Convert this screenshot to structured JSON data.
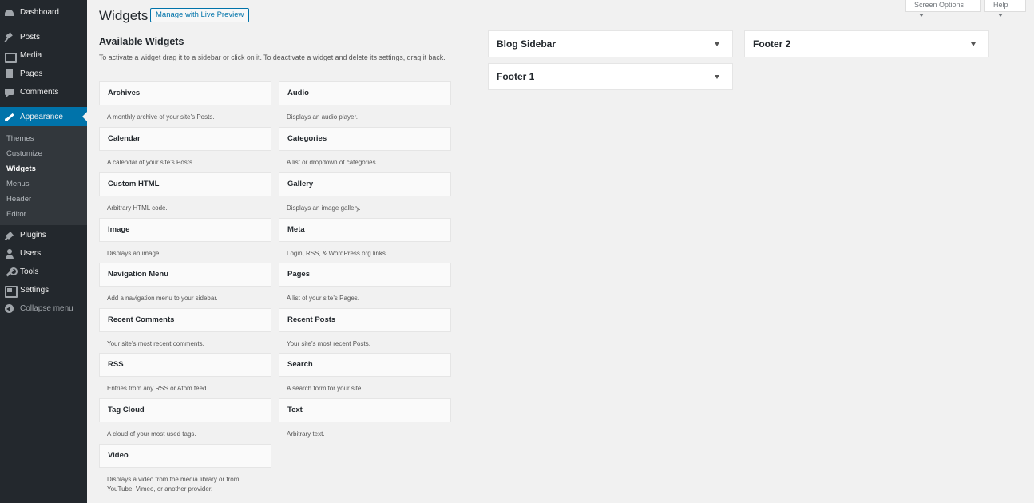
{
  "menu": {
    "items": [
      {
        "label": "Dashboard",
        "icon": "dashboard-icon"
      },
      {
        "label": "Posts",
        "icon": "pushpin-icon"
      },
      {
        "label": "Media",
        "icon": "media-icon"
      },
      {
        "label": "Pages",
        "icon": "pages-icon"
      },
      {
        "label": "Comments",
        "icon": "comments-icon"
      },
      {
        "label": "Appearance",
        "icon": "paintbrush-icon"
      },
      {
        "label": "Plugins",
        "icon": "plugin-icon"
      },
      {
        "label": "Users",
        "icon": "users-icon"
      },
      {
        "label": "Tools",
        "icon": "wrench-icon"
      },
      {
        "label": "Settings",
        "icon": "settings-icon"
      },
      {
        "label": "Collapse menu",
        "icon": "collapse-icon"
      }
    ],
    "submenu": [
      "Themes",
      "Customize",
      "Widgets",
      "Menus",
      "Header",
      "Editor"
    ],
    "active_submenu": "Widgets"
  },
  "header": {
    "title": "Widgets",
    "live_preview_label": "Manage with Live Preview",
    "screen_options_label": "Screen Options",
    "help_label": "Help"
  },
  "available": {
    "title": "Available Widgets",
    "description": "To activate a widget drag it to a sidebar or click on it. To deactivate a widget and delete its settings, drag it back."
  },
  "widgets": [
    {
      "name": "Archives",
      "desc": "A monthly archive of your site’s Posts."
    },
    {
      "name": "Audio",
      "desc": "Displays an audio player."
    },
    {
      "name": "Calendar",
      "desc": "A calendar of your site’s Posts."
    },
    {
      "name": "Categories",
      "desc": "A list or dropdown of categories."
    },
    {
      "name": "Custom HTML",
      "desc": "Arbitrary HTML code."
    },
    {
      "name": "Gallery",
      "desc": "Displays an image gallery."
    },
    {
      "name": "Image",
      "desc": "Displays an image."
    },
    {
      "name": "Meta",
      "desc": "Login, RSS, & WordPress.org links."
    },
    {
      "name": "Navigation Menu",
      "desc": "Add a navigation menu to your sidebar."
    },
    {
      "name": "Pages",
      "desc": "A list of your site’s Pages."
    },
    {
      "name": "Recent Comments",
      "desc": "Your site’s most recent comments."
    },
    {
      "name": "Recent Posts",
      "desc": "Your site’s most recent Posts."
    },
    {
      "name": "RSS",
      "desc": "Entries from any RSS or Atom feed."
    },
    {
      "name": "Search",
      "desc": "A search form for your site."
    },
    {
      "name": "Tag Cloud",
      "desc": "A cloud of your most used tags."
    },
    {
      "name": "Text",
      "desc": "Arbitrary text."
    },
    {
      "name": "Video",
      "desc": "Displays a video from the media library or from YouTube, Vimeo, or another provider."
    }
  ],
  "sidebars": [
    "Blog Sidebar",
    "Footer 2",
    "Footer 1"
  ],
  "colors": {
    "admin_bg": "#23282d",
    "submenu_bg": "#32373c",
    "accent": "#0073aa",
    "page_bg": "#f1f1f1"
  }
}
